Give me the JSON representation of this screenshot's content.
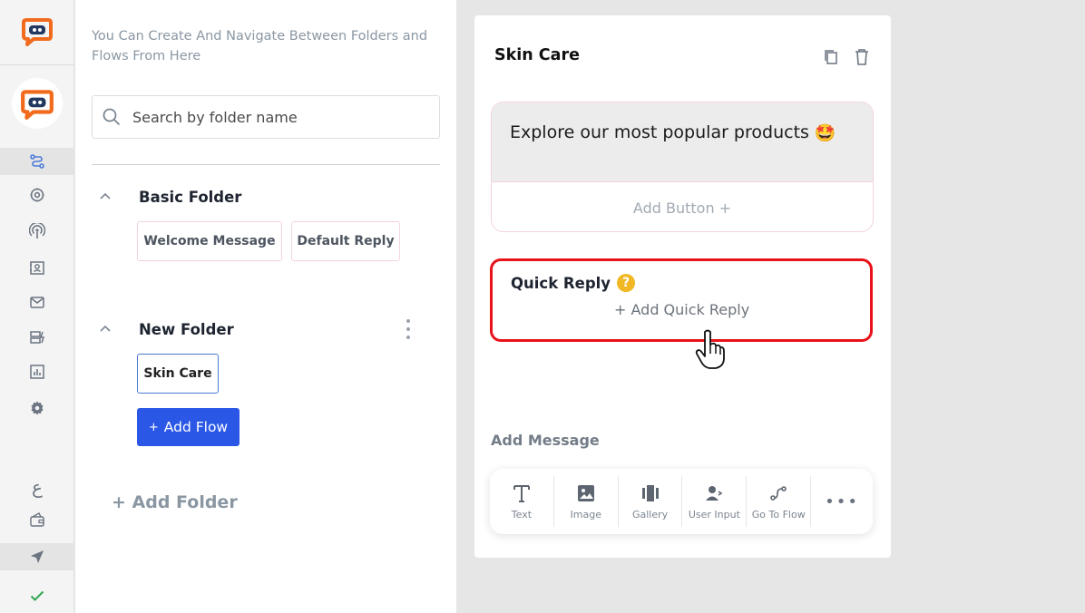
{
  "sidebar": {
    "items": [
      {
        "icon": "flow-icon",
        "active": true
      },
      {
        "icon": "bot-settings-icon"
      },
      {
        "icon": "broadcast-icon"
      },
      {
        "icon": "contacts-icon"
      },
      {
        "icon": "mail-icon"
      },
      {
        "icon": "automation-icon"
      },
      {
        "icon": "analytics-icon"
      },
      {
        "icon": "gear-icon"
      }
    ],
    "bottom": {
      "language_glyph": "ع",
      "wallet_icon": "wallet-icon",
      "send_icon": "send-icon",
      "check_icon": "check-icon"
    },
    "accent_color": "#f26b1d"
  },
  "panel": {
    "hint": "You Can Create And Navigate Between Folders and Flows From Here",
    "search_placeholder": "Search by folder name",
    "folders": [
      {
        "name": "Basic Folder",
        "flows": [
          "Welcome Message",
          "Default Reply"
        ]
      },
      {
        "name": "New Folder",
        "flows": [
          "Skin Care"
        ]
      }
    ],
    "add_flow_label": "Add Flow",
    "add_flow_plus": "+",
    "add_folder_label": "+ Add Folder"
  },
  "editor": {
    "title": "Skin Care",
    "message": {
      "text": "Explore our most popular products",
      "emoji": "🤩",
      "add_button_label": "Add Button +"
    },
    "quick_reply": {
      "title": "Quick Reply",
      "help": "?",
      "add_label": "+ Add Quick Reply",
      "highlight_color": "#e8121a"
    },
    "add_message_label": "Add Message",
    "tools": [
      {
        "label": "Text",
        "icon": "text-icon"
      },
      {
        "label": "Image",
        "icon": "image-icon"
      },
      {
        "label": "Gallery",
        "icon": "gallery-icon"
      },
      {
        "label": "User Input",
        "icon": "user-input-icon"
      },
      {
        "label": "Go To Flow",
        "icon": "go-to-flow-icon"
      }
    ],
    "more_label": "•••"
  },
  "colors": {
    "primary_button": "#2b57e6",
    "muted_text": "#8a97a3"
  }
}
